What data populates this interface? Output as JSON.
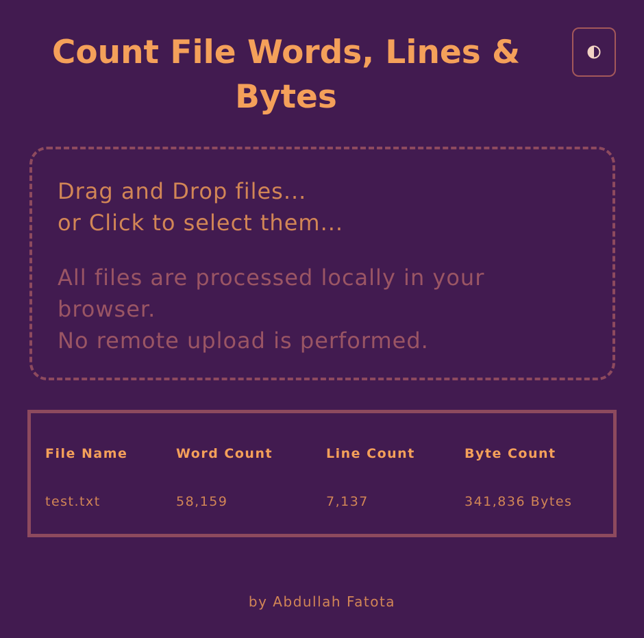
{
  "header": {
    "title": "Count File Words, Lines & Bytes",
    "theme_toggle_icon": "contrast-icon"
  },
  "dropzone": {
    "line1": "Drag and Drop files...",
    "line2": "or Click to select them...",
    "privacy_line1": "All files are processed locally in your browser.",
    "privacy_line2": "No remote upload is performed."
  },
  "results": {
    "columns": [
      "File Name",
      "Word Count",
      "Line Count",
      "Byte Count"
    ],
    "rows": [
      {
        "file_name": "test.txt",
        "word_count": "58,159",
        "line_count": "7,137",
        "byte_count": "341,836 Bytes"
      }
    ]
  },
  "footer": {
    "credit": "by Abdullah Fatota"
  },
  "colors": {
    "background": "#421b50",
    "accent": "#f4a05a",
    "text": "#d28656",
    "muted": "#9a5564",
    "border": "#8d4a5e"
  }
}
